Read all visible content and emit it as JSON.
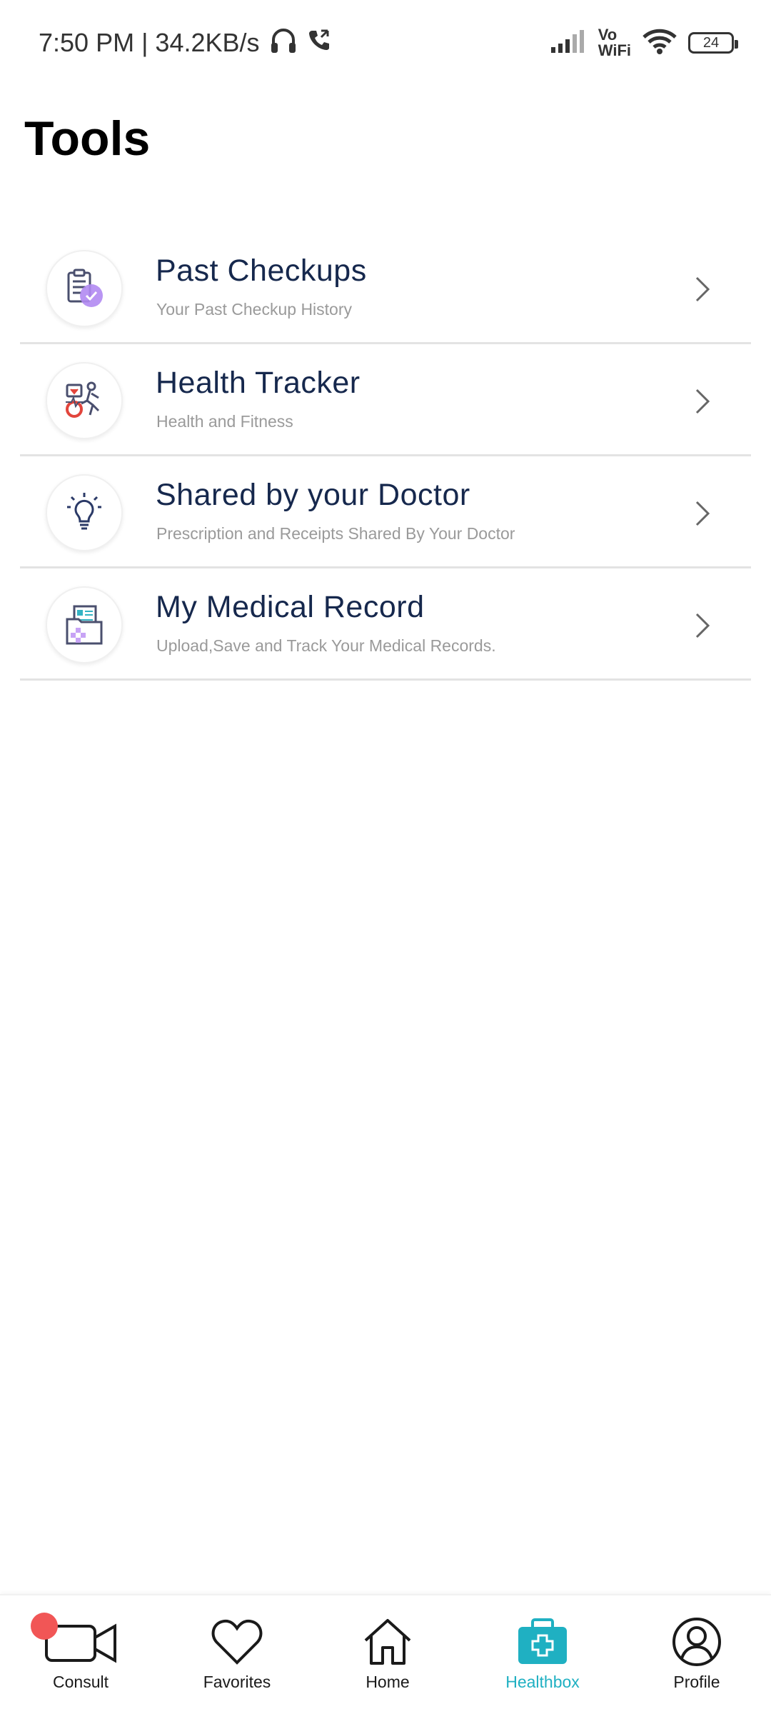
{
  "status_bar": {
    "time_speed": "7:50 PM | 34.2KB/s",
    "vowifi_top": "Vo",
    "vowifi_bottom": "WiFi",
    "battery": "24"
  },
  "page": {
    "title": "Tools"
  },
  "tools": [
    {
      "title": "Past Checkups",
      "subtitle": "Your Past Checkup History",
      "icon": "clipboard-check-icon"
    },
    {
      "title": "Health Tracker",
      "subtitle": "Health and Fitness",
      "icon": "fitness-tracker-icon"
    },
    {
      "title": "Shared by your Doctor",
      "subtitle": "Prescription and Receipts Shared By Your Doctor",
      "icon": "lightbulb-icon"
    },
    {
      "title": "My Medical Record",
      "subtitle": "Upload,Save and Track Your Medical Records.",
      "icon": "medical-folder-icon"
    }
  ],
  "bottom_nav": {
    "items": [
      {
        "label": "Consult",
        "icon": "video-camera-icon"
      },
      {
        "label": "Favorites",
        "icon": "heart-icon"
      },
      {
        "label": "Home",
        "icon": "home-icon"
      },
      {
        "label": "Healthbox",
        "icon": "medical-kit-icon"
      },
      {
        "label": "Profile",
        "icon": "user-icon"
      }
    ],
    "active": "Healthbox"
  },
  "colors": {
    "title_text": "#16284d",
    "subtitle_text": "#9a9a9a",
    "accent": "#1fb0c2",
    "notification": "#f15656"
  }
}
